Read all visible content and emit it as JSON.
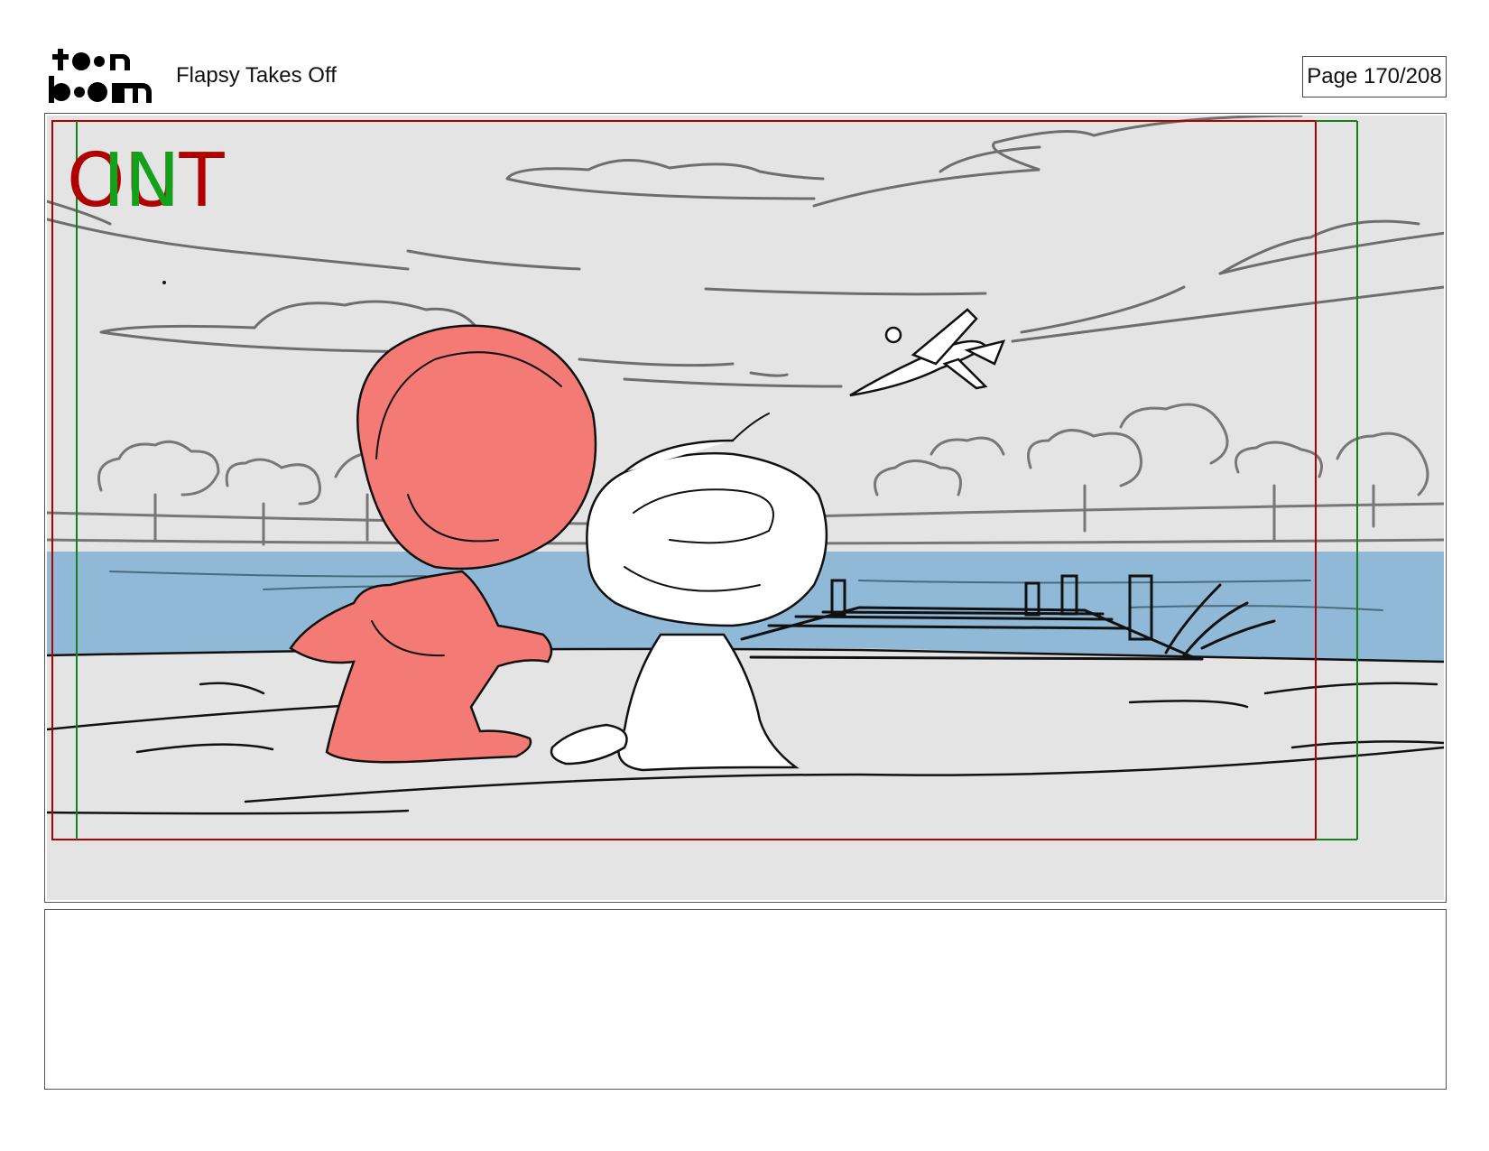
{
  "header": {
    "logo_text_top": "toon",
    "logo_text_bottom": "boom",
    "title": "Flapsy Takes Off",
    "page_label": "Page 170/208"
  },
  "panel": {
    "marker_out": "OUT",
    "marker_in": "IN",
    "colors": {
      "sky": "#e4e4e4",
      "water": "#8fb9d6",
      "red_character": "#f47a76",
      "out_frame": "#b00000",
      "in_frame": "#13801a"
    },
    "content_icons": [
      "red-character-sketch",
      "white-character-sketch",
      "airplane-sketch",
      "dock-sketch",
      "tree-line-sketch"
    ]
  },
  "notes": {
    "text": ""
  }
}
